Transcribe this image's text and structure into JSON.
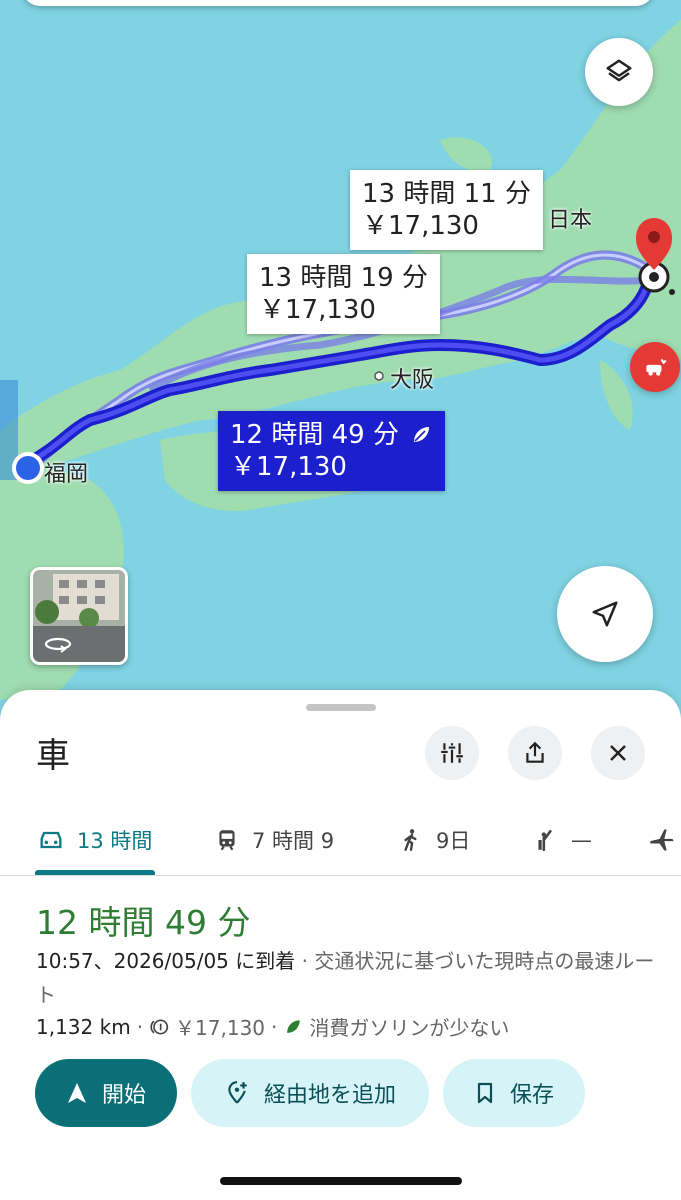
{
  "map": {
    "callouts": [
      {
        "time": "13 時間 11 分",
        "cost": "￥17,130"
      },
      {
        "time": "13 時間 19 分",
        "cost": "￥17,130"
      },
      {
        "time": "12 時間 49 分",
        "cost": "￥17,130"
      }
    ],
    "places": {
      "japan": "日本",
      "osaka": "大阪",
      "fukuoka": "福岡"
    },
    "colors": {
      "water": "#7fd3e3",
      "land": "#9fdcb0",
      "route_selected": "#2b2bd9",
      "route_alt": "#7a7fe6"
    }
  },
  "sheet": {
    "title": "車",
    "tabs": [
      {
        "label": "13 時間",
        "icon": "car-icon"
      },
      {
        "label": "7 時間 9",
        "icon": "train-icon"
      },
      {
        "label": "9日",
        "icon": "walk-icon"
      },
      {
        "label": "—",
        "icon": "ride-hail-icon"
      },
      {
        "label": "",
        "icon": "flight-icon"
      }
    ],
    "duration": "12 時間 49 分",
    "arrival": "10:57、2026/05/05 に到着",
    "route_note": "· 交通状況に基づいた現時点の最速ルート",
    "distance": "1,132 km",
    "toll": "￥17,130",
    "eco": "消費ガソリンが少ない",
    "buttons": {
      "start": "開始",
      "add_stop": "経由地を追加",
      "save": "保存"
    }
  }
}
